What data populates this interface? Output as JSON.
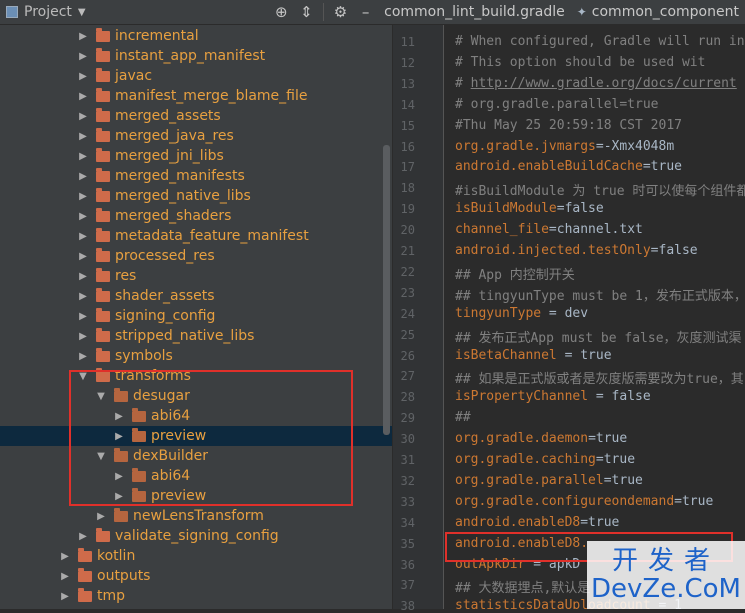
{
  "topbar": {
    "project_label": "Project",
    "tabs": [
      {
        "label": "common_lint_build.gradle",
        "icon": "gradle-icon"
      },
      {
        "label": "common_component",
        "icon": "gradle-icon"
      }
    ]
  },
  "tree": {
    "rows": [
      {
        "label": "incremental",
        "depth": 2,
        "style": "orange",
        "expanded": false,
        "selected": false
      },
      {
        "label": "instant_app_manifest",
        "depth": 2,
        "style": "orange",
        "expanded": false,
        "selected": false
      },
      {
        "label": "javac",
        "depth": 2,
        "style": "orange",
        "expanded": false,
        "selected": false
      },
      {
        "label": "manifest_merge_blame_file",
        "depth": 2,
        "style": "orange",
        "expanded": false,
        "selected": false
      },
      {
        "label": "merged_assets",
        "depth": 2,
        "style": "orange",
        "expanded": false,
        "selected": false
      },
      {
        "label": "merged_java_res",
        "depth": 2,
        "style": "orange",
        "expanded": false,
        "selected": false
      },
      {
        "label": "merged_jni_libs",
        "depth": 2,
        "style": "orange",
        "expanded": false,
        "selected": false
      },
      {
        "label": "merged_manifests",
        "depth": 2,
        "style": "orange",
        "expanded": false,
        "selected": false
      },
      {
        "label": "merged_native_libs",
        "depth": 2,
        "style": "orange",
        "expanded": false,
        "selected": false
      },
      {
        "label": "merged_shaders",
        "depth": 2,
        "style": "orange",
        "expanded": false,
        "selected": false
      },
      {
        "label": "metadata_feature_manifest",
        "depth": 2,
        "style": "orange",
        "expanded": false,
        "selected": false
      },
      {
        "label": "processed_res",
        "depth": 2,
        "style": "orange",
        "expanded": false,
        "selected": false
      },
      {
        "label": "res",
        "depth": 2,
        "style": "orange",
        "expanded": false,
        "selected": false
      },
      {
        "label": "shader_assets",
        "depth": 2,
        "style": "orange",
        "expanded": false,
        "selected": false
      },
      {
        "label": "signing_config",
        "depth": 2,
        "style": "orange",
        "expanded": false,
        "selected": false
      },
      {
        "label": "stripped_native_libs",
        "depth": 2,
        "style": "orange",
        "expanded": false,
        "selected": false
      },
      {
        "label": "symbols",
        "depth": 2,
        "style": "orange",
        "expanded": false,
        "selected": false
      },
      {
        "label": "transforms",
        "depth": 2,
        "style": "orange",
        "expanded": true,
        "selected": false
      },
      {
        "label": "desugar",
        "depth": 3,
        "style": "orange",
        "expanded": true,
        "selected": false
      },
      {
        "label": "abi64",
        "depth": 4,
        "style": "orange",
        "expanded": false,
        "selected": false
      },
      {
        "label": "preview",
        "depth": 4,
        "style": "orange",
        "expanded": false,
        "selected": true
      },
      {
        "label": "dexBuilder",
        "depth": 3,
        "style": "orange",
        "expanded": true,
        "selected": false
      },
      {
        "label": "abi64",
        "depth": 4,
        "style": "orange",
        "expanded": false,
        "selected": false
      },
      {
        "label": "preview",
        "depth": 4,
        "style": "orange",
        "expanded": false,
        "selected": false
      },
      {
        "label": "newLensTransform",
        "depth": 3,
        "style": "orange",
        "expanded": false,
        "selected": false
      },
      {
        "label": "validate_signing_config",
        "depth": 2,
        "style": "orange",
        "expanded": false,
        "selected": false
      },
      {
        "label": "kotlin",
        "depth": 1,
        "style": "orange",
        "expanded": false,
        "selected": false
      },
      {
        "label": "outputs",
        "depth": 1,
        "style": "orange",
        "expanded": false,
        "selected": false
      },
      {
        "label": "tmp",
        "depth": 1,
        "style": "orange",
        "expanded": false,
        "selected": false
      }
    ]
  },
  "editor": {
    "lines": [
      {
        "num": "11",
        "parts": [
          {
            "t": "# When configured, Gradle will run in",
            "c": "comment"
          }
        ]
      },
      {
        "num": "12",
        "parts": [
          {
            "t": "# This option should be used wit",
            "c": "comment"
          }
        ]
      },
      {
        "num": "13",
        "parts": [
          {
            "t": "# ",
            "c": "comment"
          },
          {
            "t": "http://www.gradle.org/docs/current",
            "c": "link"
          }
        ]
      },
      {
        "num": "14",
        "parts": [
          {
            "t": "# org.gradle.parallel=true",
            "c": "comment"
          }
        ]
      },
      {
        "num": "15",
        "parts": [
          {
            "t": "#Thu May 25 20:59:18 CST 2017",
            "c": "comment"
          }
        ]
      },
      {
        "num": "16",
        "parts": [
          {
            "t": "org.gradle.jvmargs",
            "c": "key"
          },
          {
            "t": "=-Xmx4048m",
            "c": "val"
          }
        ]
      },
      {
        "num": "17",
        "parts": [
          {
            "t": "android.enableBuildCache",
            "c": "key"
          },
          {
            "t": "=true",
            "c": "val"
          }
        ]
      },
      {
        "num": "18",
        "parts": [
          {
            "t": "#isBuildModule 为 true 时可以使每个组件都",
            "c": "comment"
          }
        ]
      },
      {
        "num": "19",
        "parts": [
          {
            "t": "isBuildModule",
            "c": "key"
          },
          {
            "t": "=false",
            "c": "val"
          }
        ]
      },
      {
        "num": "20",
        "parts": [
          {
            "t": "channel_file",
            "c": "key"
          },
          {
            "t": "=channel.txt",
            "c": "val"
          }
        ]
      },
      {
        "num": "21",
        "parts": [
          {
            "t": "android.injected.testOnly",
            "c": "key"
          },
          {
            "t": "=false",
            "c": "val"
          }
        ]
      },
      {
        "num": "22",
        "parts": [
          {
            "t": "## App 内控制开关",
            "c": "comment"
          }
        ]
      },
      {
        "num": "23",
        "parts": [
          {
            "t": "## tingyunType must be 1，发布正式版本，",
            "c": "comment"
          }
        ]
      },
      {
        "num": "24",
        "parts": [
          {
            "t": "tingyunType",
            "c": "key"
          },
          {
            "t": " = dev",
            "c": "val"
          }
        ]
      },
      {
        "num": "25",
        "parts": [
          {
            "t": "## 发布正式App must be false，灰度测试渠",
            "c": "comment"
          }
        ]
      },
      {
        "num": "26",
        "parts": [
          {
            "t": "isBetaChannel",
            "c": "key"
          },
          {
            "t": " = true",
            "c": "val"
          }
        ]
      },
      {
        "num": "27",
        "parts": [
          {
            "t": "## 如果是正式版或者是灰度版需要改为true，其",
            "c": "comment"
          }
        ]
      },
      {
        "num": "28",
        "parts": [
          {
            "t": "isPropertyChannel",
            "c": "key"
          },
          {
            "t": " = false",
            "c": "val"
          }
        ]
      },
      {
        "num": "29",
        "parts": [
          {
            "t": "##",
            "c": "comment"
          }
        ]
      },
      {
        "num": "30",
        "parts": [
          {
            "t": "org.gradle.daemon",
            "c": "key"
          },
          {
            "t": "=true",
            "c": "val"
          }
        ]
      },
      {
        "num": "31",
        "parts": [
          {
            "t": "org.gradle.caching",
            "c": "key"
          },
          {
            "t": "=true",
            "c": "val"
          }
        ]
      },
      {
        "num": "32",
        "parts": [
          {
            "t": "org.gradle.parallel",
            "c": "key"
          },
          {
            "t": "=true",
            "c": "val"
          }
        ]
      },
      {
        "num": "33",
        "parts": [
          {
            "t": "org.gradle.configureondemand",
            "c": "key"
          },
          {
            "t": "=true",
            "c": "val"
          }
        ]
      },
      {
        "num": "34",
        "parts": [
          {
            "t": "android.enableD8",
            "c": "key"
          },
          {
            "t": "=true",
            "c": "val"
          }
        ]
      },
      {
        "num": "35",
        "parts": [
          {
            "t": "android.enableD8.",
            "c": "key"
          }
        ]
      },
      {
        "num": "36",
        "parts": [
          {
            "t": "outApkDir",
            "c": "key"
          },
          {
            "t": " = apkD",
            "c": "val"
          }
        ]
      },
      {
        "num": "37",
        "parts": [
          {
            "t": "## 大数据埋点,默认是",
            "c": "comment"
          }
        ]
      },
      {
        "num": "38",
        "parts": [
          {
            "t": "statisticsDataUploadcount",
            "c": "key"
          },
          {
            "t": " = 1",
            "c": "val"
          }
        ]
      }
    ]
  },
  "watermark": {
    "line1": "开发者",
    "line2": "DevZe.CoM"
  }
}
